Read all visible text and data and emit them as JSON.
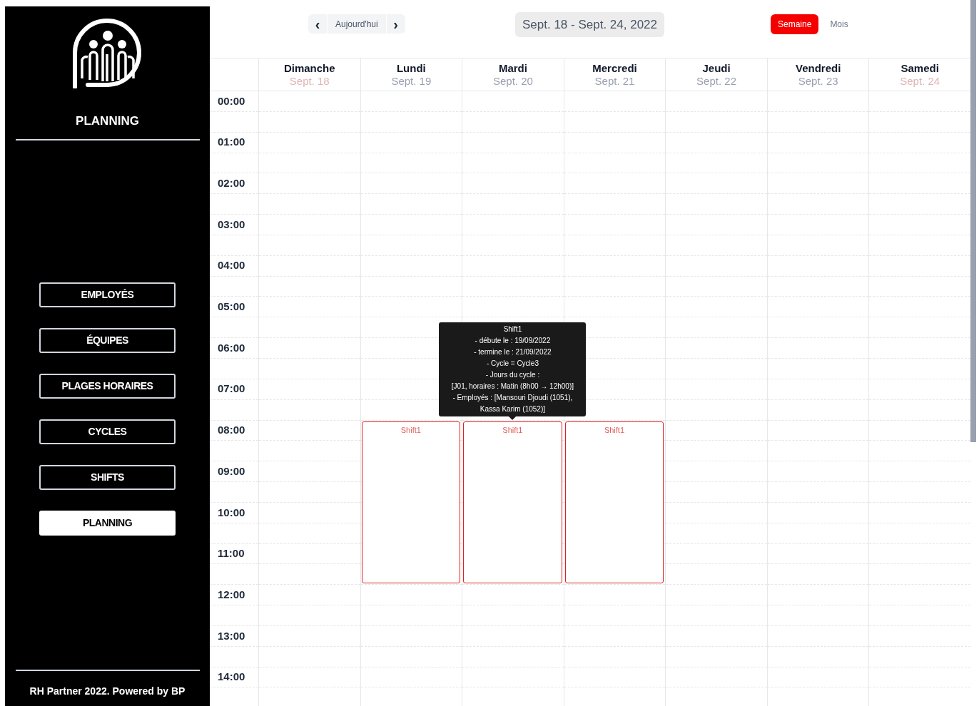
{
  "sidebar": {
    "title": "PLANNING",
    "items": [
      {
        "label": "EMPLOYÉS",
        "selected": false
      },
      {
        "label": "ÉQUIPES",
        "selected": false
      },
      {
        "label": "PLAGES HORAIRES",
        "selected": false
      },
      {
        "label": "CYCLES",
        "selected": false
      },
      {
        "label": "SHIFTS",
        "selected": false
      },
      {
        "label": "PLANNING",
        "selected": true
      }
    ],
    "footer": "RH Partner 2022. Powered by BP"
  },
  "toolbar": {
    "prev": "‹",
    "today": "Aujourd'hui",
    "next": "›",
    "range": "Sept. 18 - Sept. 24, 2022",
    "views": [
      {
        "label": "Semaine",
        "selected": true
      },
      {
        "label": "Mois",
        "selected": false
      }
    ]
  },
  "days": [
    {
      "name": "Dimanche",
      "date": "Sept. 18",
      "weekend": true
    },
    {
      "name": "Lundi",
      "date": "Sept. 19",
      "weekend": false,
      "events": [
        {
          "title": "Shift1"
        }
      ]
    },
    {
      "name": "Mardi",
      "date": "Sept. 20",
      "weekend": false,
      "events": [
        {
          "title": "Shift1",
          "tooltip": [
            "Shift1",
            "- débute le : 19/09/2022",
            "- termine le : 21/09/2022",
            "- Cycle = Cycle3",
            "- Jours du cycle :",
            "[J01, horaires : Matin (8h00 → 12h00)]",
            "- Employés : [Mansouri Djoudi (1051),",
            "Kassa Karim (1052)]"
          ]
        }
      ]
    },
    {
      "name": "Mercredi",
      "date": "Sept. 21",
      "weekend": false,
      "events": [
        {
          "title": "Shift1"
        }
      ]
    },
    {
      "name": "Jeudi",
      "date": "Sept. 22",
      "weekend": false
    },
    {
      "name": "Vendredi",
      "date": "Sept. 23",
      "weekend": false
    },
    {
      "name": "Samedi",
      "date": "Sept. 24",
      "weekend": true
    }
  ],
  "hours": [
    {
      "label": "00:00",
      "booked": [
        false,
        false,
        false,
        false,
        false,
        false,
        false
      ]
    },
    {
      "label": "01:00",
      "booked": [
        false,
        false,
        false,
        false,
        false,
        false,
        false
      ]
    },
    {
      "label": "02:00",
      "booked": [
        false,
        false,
        false,
        false,
        false,
        false,
        false
      ]
    },
    {
      "label": "03:00",
      "booked": [
        false,
        false,
        false,
        false,
        false,
        false,
        false
      ]
    },
    {
      "label": "04:00",
      "booked": [
        false,
        false,
        false,
        false,
        false,
        false,
        false
      ]
    },
    {
      "label": "05:00",
      "booked": [
        false,
        false,
        false,
        false,
        false,
        false,
        false
      ]
    },
    {
      "label": "06:00",
      "booked": [
        false,
        false,
        false,
        false,
        false,
        false,
        false
      ]
    },
    {
      "label": "07:00",
      "booked": [
        false,
        false,
        false,
        false,
        false,
        false,
        false
      ]
    },
    {
      "label": "08:00",
      "booked": [
        false,
        true,
        true,
        true,
        false,
        false,
        false
      ]
    },
    {
      "label": "09:00",
      "booked": [
        false,
        true,
        true,
        true,
        false,
        false,
        false
      ]
    },
    {
      "label": "10:00",
      "booked": [
        false,
        true,
        true,
        true,
        false,
        false,
        false
      ]
    },
    {
      "label": "11:00",
      "booked": [
        false,
        true,
        true,
        true,
        false,
        false,
        false
      ]
    },
    {
      "label": "12:00",
      "booked": [
        false,
        false,
        false,
        false,
        false,
        false,
        false
      ]
    },
    {
      "label": "13:00",
      "booked": [
        false,
        false,
        false,
        false,
        false,
        false,
        false
      ]
    },
    {
      "label": "14:00",
      "booked": [
        false,
        false,
        false,
        false,
        false,
        false,
        false
      ]
    }
  ]
}
